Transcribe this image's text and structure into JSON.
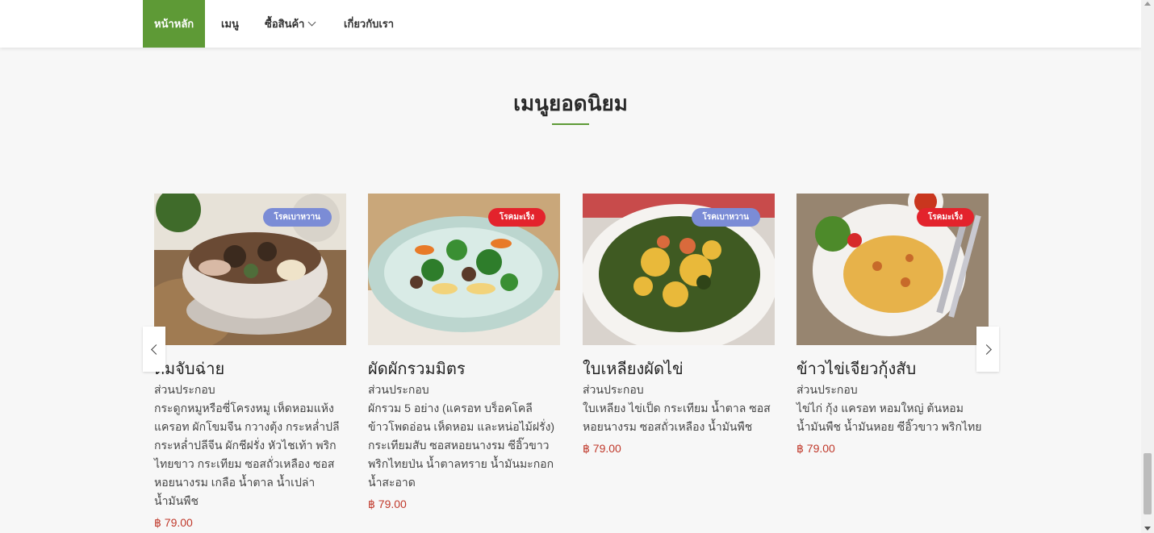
{
  "nav": {
    "items": [
      {
        "label": "หน้าหลัก",
        "active": true
      },
      {
        "label": "เมนู"
      },
      {
        "label": "ซื้อสินค้า",
        "dropdown": true
      },
      {
        "label": "เกี่ยวกับเรา"
      }
    ]
  },
  "section": {
    "title": "เมนูยอดนิยม"
  },
  "colors": {
    "accent": "#5e9a36",
    "badge_diabetes": "#7b8cd6",
    "badge_cancer": "#e3232c",
    "price": "#c0392b"
  },
  "cards": [
    {
      "badge": "โรคเบาหวาน",
      "name": "ต้มจับฉ่าย",
      "sub": "ส่วนประกอบ",
      "desc": "กระดูกหมูหรือซี่โครงหมู เห็ดหอมแห้ง แครอท ผักโขมจีน กวางตุ้ง กระหล่ำปลี กระหล่ำปลีจีน ผักชีฝรั่ง หัวไชเท้า พริกไทยขาว กระเทียม ซอสถั่วเหลือง ซอสหอยนางรม เกลือ น้ำตาล น้ำเปล่า น้ำมันพืช",
      "price": "฿ 79.00"
    },
    {
      "badge": "โรคมะเร็ง",
      "name": "ผัดผักรวมมิตร",
      "sub": "ส่วนประกอบ",
      "desc": "ผักรวม 5 อย่าง (แครอท บร็อคโคลี ข้าวโพดอ่อน เห็ดหอม และหน่อไม้ฝรั่ง) กระเทียมสับ ซอสหอยนางรม ซีอิ๊วขาว พริกไทยป่น น้ำตาลทราย น้ำมันมะกอก น้ำสะอาด",
      "price": "฿ 79.00"
    },
    {
      "badge": "โรคเบาหวาน",
      "name": "ใบเหลียงผัดไข่",
      "sub": "ส่วนประกอบ",
      "desc": "ใบเหลียง ไข่เป็ด กระเทียม น้ำตาล ซอสหอยนางรม ซอสถั่วเหลือง น้ำมันพืช",
      "price": "฿ 79.00"
    },
    {
      "badge": "โรคมะเร็ง",
      "name": "ข้าวไข่เจียวกุ้งสับ",
      "sub": "ส่วนประกอบ",
      "desc": "ไข่ไก่ กุ้ง แครอท หอมใหญ่ ต้นหอม น้ำมันพืช น้ำมันหอย ซีอิ๊วขาว พริกไทย",
      "price": "฿ 79.00"
    }
  ]
}
